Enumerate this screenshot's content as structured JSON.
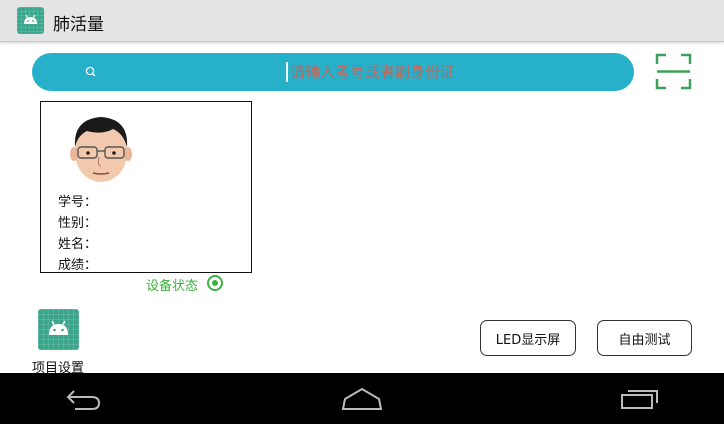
{
  "app": {
    "title": "肺活量"
  },
  "search": {
    "placeholder": "请输入考号或者刷身份证"
  },
  "student": {
    "id_label": "学号：",
    "gender_label": "性别：",
    "name_label": "姓名：",
    "score_label": "成绩："
  },
  "status": {
    "device_label": "设备状态",
    "color": "#3db043"
  },
  "bottom": {
    "project_settings_label": "项目设置",
    "led_button_label": "LED显示屏",
    "free_test_button_label": "自由测试"
  },
  "icons": {
    "app": "android-icon",
    "search": "search-icon",
    "scan": "scan-icon",
    "back": "back-icon",
    "home": "home-icon",
    "recents": "recents-icon"
  },
  "colors": {
    "accent": "#27b0c9",
    "brand": "#3aa58a",
    "status": "#3db043"
  }
}
